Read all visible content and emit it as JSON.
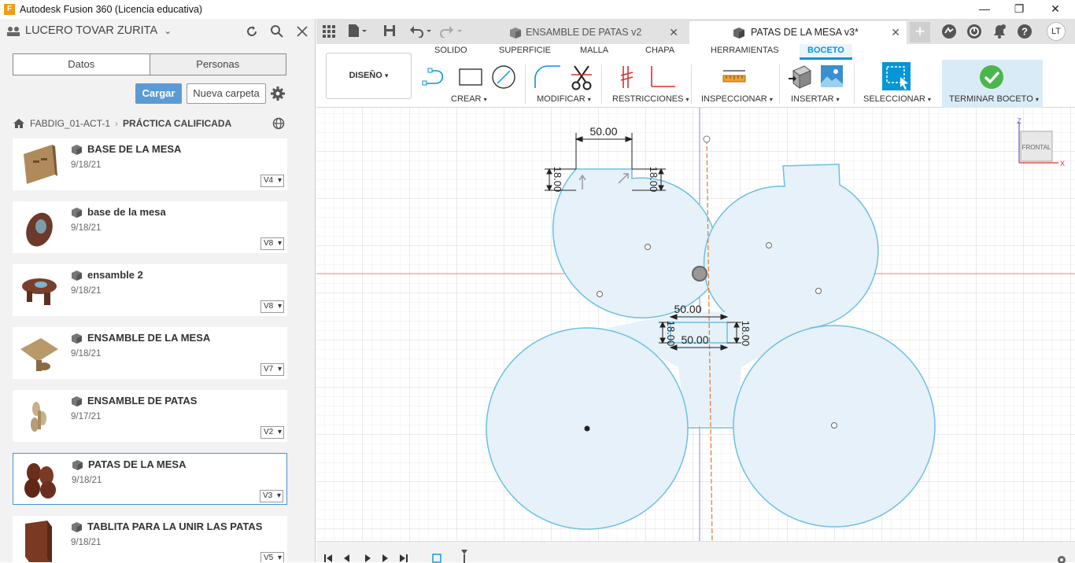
{
  "window": {
    "title": "Autodesk Fusion 360 (Licencia educativa)"
  },
  "panel": {
    "user": "LUCERO TOVAR ZURITA",
    "tabs": [
      "Datos",
      "Personas"
    ],
    "upload_label": "Cargar",
    "new_folder_label": "Nueva carpeta",
    "breadcrumb": {
      "project": "FABDIG_01-ACT-1",
      "folder": "PRÁCTICA CALIFICADA"
    },
    "files": [
      {
        "name": "BASE DE LA MESA",
        "date": "9/18/21",
        "version": "V4"
      },
      {
        "name": "base de la mesa",
        "date": "9/18/21",
        "version": "V8"
      },
      {
        "name": "ensamble 2",
        "date": "9/18/21",
        "version": "V8"
      },
      {
        "name": "ENSAMBLE DE LA MESA",
        "date": "9/18/21",
        "version": "V7"
      },
      {
        "name": "ENSAMBLE DE PATAS",
        "date": "9/17/21",
        "version": "V2"
      },
      {
        "name": "PATAS DE LA MESA",
        "date": "9/18/21",
        "version": "V3"
      },
      {
        "name": "TABLITA PARA LA UNIR LAS PATAS",
        "date": "9/18/21",
        "version": "V5"
      }
    ]
  },
  "doc_tabs": [
    {
      "label": "ENSAMBLE DE PATAS v2",
      "active": false
    },
    {
      "label": "PATAS DE LA MESA v3*",
      "active": true
    }
  ],
  "user_initials": "LT",
  "toolbar": {
    "workspace": "DISEÑO",
    "tabs": [
      "SOLIDO",
      "SUPERFICIE",
      "MALLA",
      "CHAPA",
      "HERRAMIENTAS",
      "BOCETO"
    ],
    "groups": [
      "CREAR",
      "MODIFICAR",
      "RESTRICCIONES",
      "INSPECCIONAR",
      "INSERTAR",
      "SELECCIONAR",
      "TERMINAR BOCETO"
    ]
  },
  "viewcube": {
    "face": "FRONTAL",
    "z": "Z",
    "x": "X"
  },
  "dimensions": {
    "top_width": "50.00",
    "left_height": "18.00",
    "right_height": "18.00",
    "slot_width_top": "50.00",
    "slot_width_bottom": "50.00",
    "slot_height_left": "18.00",
    "slot_height_right": "18.00"
  },
  "colors": {
    "sketch_fill": "#e6f1fa",
    "sketch_stroke": "#6cc0e0",
    "accent": "#0696d7",
    "grid": "#e4e4e4"
  }
}
